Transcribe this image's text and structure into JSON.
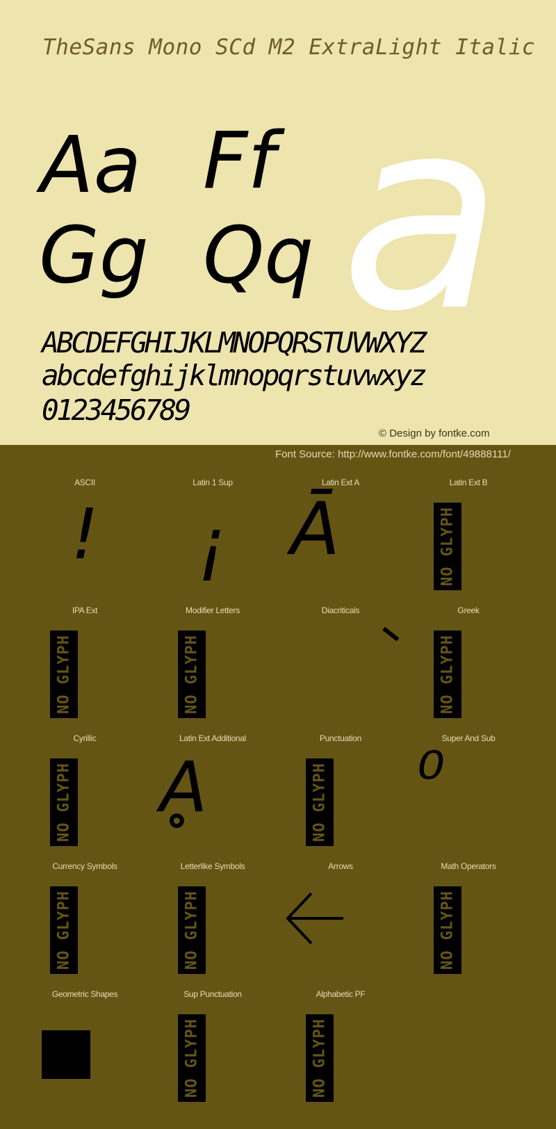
{
  "header": {
    "font_name": "TheSans Mono SCd M2 ExtraLight Italic"
  },
  "preview": {
    "pairs": [
      "Aa",
      "Ff",
      "Gg",
      "Qq"
    ],
    "hero_glyph": "a",
    "uppercase": "ABCDEFGHIJKLMNOPQRSTUVWXYZ",
    "lowercase": "abcdefghijklmnopqrstuvwxyz",
    "digits": "0123456789"
  },
  "credit": "© Design by fontke.com",
  "source": "Font Source: http://www.fontke.com/font/49888111/",
  "colors": {
    "top_background": "#EDE4AE",
    "bottom_background": "#655515",
    "hero_glyph": "#FFFFFF",
    "glyph": "#000000"
  },
  "no_glyph_text": "NO GLYPH",
  "blocks": [
    {
      "label": "ASCII",
      "glyph": "!",
      "has_glyph": true
    },
    {
      "label": "Latin 1 Sup",
      "glyph": "¡",
      "has_glyph": true
    },
    {
      "label": "Latin Ext A",
      "glyph": "Ā",
      "has_glyph": true
    },
    {
      "label": "Latin Ext B",
      "glyph": "",
      "has_glyph": false
    },
    {
      "label": "IPA Ext",
      "glyph": "",
      "has_glyph": false
    },
    {
      "label": "Modifier Letters",
      "glyph": "",
      "has_glyph": false
    },
    {
      "label": "Diacriticals",
      "glyph": "`",
      "has_glyph": true
    },
    {
      "label": "Greek",
      "glyph": "",
      "has_glyph": false
    },
    {
      "label": "Cyrillic",
      "glyph": "",
      "has_glyph": false
    },
    {
      "label": "Latin Ext Additional",
      "glyph": "Ḁ",
      "has_glyph": true
    },
    {
      "label": "Punctuation",
      "glyph": "",
      "has_glyph": false
    },
    {
      "label": "Super And Sub",
      "glyph": "⁰",
      "has_glyph": true
    },
    {
      "label": "Currency Symbols",
      "glyph": "",
      "has_glyph": false
    },
    {
      "label": "Letterlike Symbols",
      "glyph": "",
      "has_glyph": false
    },
    {
      "label": "Arrows",
      "glyph": "←",
      "has_glyph": true
    },
    {
      "label": "Math Operators",
      "glyph": "",
      "has_glyph": false
    },
    {
      "label": "Geometric Shapes",
      "glyph": "■",
      "has_glyph": true
    },
    {
      "label": "Sup Punctuation",
      "glyph": "",
      "has_glyph": false
    },
    {
      "label": "Alphabetic PF",
      "glyph": "",
      "has_glyph": false
    }
  ]
}
